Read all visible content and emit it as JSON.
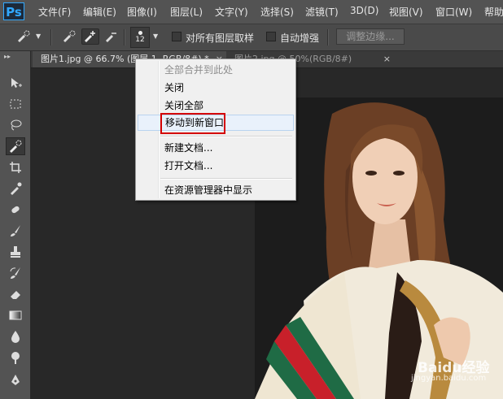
{
  "app": {
    "logo": "Ps"
  },
  "menubar": {
    "items": [
      "文件(F)",
      "编辑(E)",
      "图像(I)",
      "图层(L)",
      "文字(Y)",
      "选择(S)",
      "滤镜(T)",
      "3D(D)",
      "视图(V)",
      "窗口(W)",
      "帮助"
    ]
  },
  "options": {
    "brush_size": "12",
    "sample_all_layers_label": "对所有图层取样",
    "auto_enhance_label": "自动增强",
    "refine_edge_label": "调整边缘..."
  },
  "tabs": [
    {
      "label": "图片1.jpg @ 66.7% (图层 1, RGB/8#) *",
      "close": "×"
    },
    {
      "label": "图片2.jpg @ 50%(RGB/8#)",
      "close": "×"
    }
  ],
  "context_menu": {
    "items": [
      {
        "label": "全部合并到此处",
        "enabled": false
      },
      {
        "label": "关闭",
        "enabled": true
      },
      {
        "label": "关闭全部",
        "enabled": true
      },
      {
        "label": "移动到新窗口",
        "enabled": true,
        "highlighted": true
      },
      {
        "label": "新建文档...",
        "enabled": true
      },
      {
        "label": "打开文档...",
        "enabled": true
      },
      {
        "label": "在资源管理器中显示",
        "enabled": true
      }
    ]
  },
  "watermark": {
    "brand": "Baidu经验",
    "url": "jingyan.baidu.com"
  },
  "colors": {
    "accent": "#31a8ff",
    "highlight_box": "#d40000",
    "stripe_red": "#c8202a",
    "stripe_green": "#1f6b45"
  },
  "icons": [
    "move-icon",
    "marquee-icon",
    "lasso-icon",
    "quick-selection-icon",
    "crop-icon",
    "eyedropper-icon",
    "healing-brush-icon",
    "brush-icon",
    "clone-stamp-icon",
    "history-brush-icon",
    "eraser-icon",
    "gradient-icon",
    "blur-icon",
    "dodge-icon",
    "pen-icon"
  ]
}
